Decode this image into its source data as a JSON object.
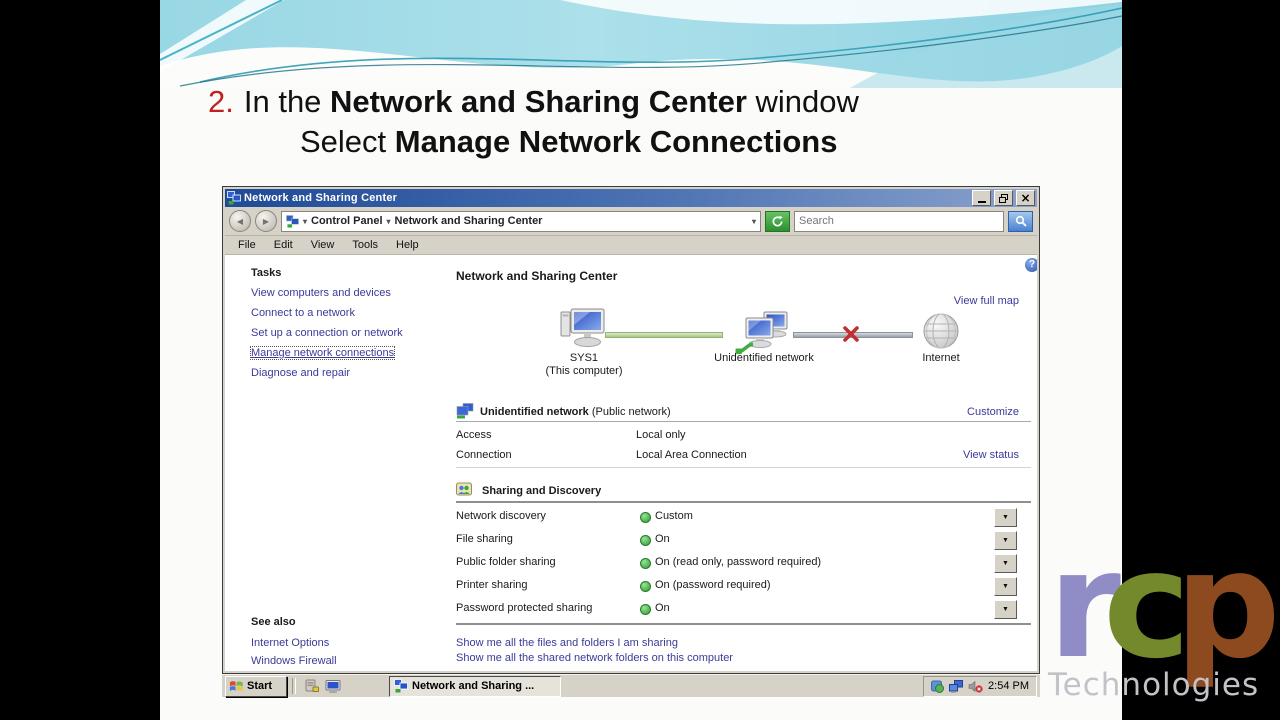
{
  "slide": {
    "step_number": "2.",
    "title": {
      "pre1": "In the ",
      "bold1": "Network and Sharing Center",
      "post1": " window",
      "pre2": "Select ",
      "bold2": "Manage Network Connections"
    }
  },
  "window": {
    "title": "Network and Sharing Center",
    "address": {
      "root": "Control Panel",
      "current": "Network and Sharing Center",
      "search_placeholder": "Search"
    },
    "menu": [
      "File",
      "Edit",
      "View",
      "Tools",
      "Help"
    ],
    "tasks": {
      "header": "Tasks",
      "items": [
        "View computers and devices",
        "Connect to a network",
        "Set up a connection or network",
        "Manage network connections",
        "Diagnose and repair"
      ],
      "selected": "Manage network connections"
    },
    "see_also": {
      "header": "See also",
      "items": [
        "Internet Options",
        "Windows Firewall"
      ]
    },
    "main": {
      "heading": "Network and Sharing Center",
      "view_full_map": "View full map",
      "map": {
        "nodes": [
          {
            "label": "SYS1",
            "sublabel": "(This computer)"
          },
          {
            "label": "Unidentified network",
            "sublabel": ""
          },
          {
            "label": "Internet",
            "sublabel": ""
          }
        ],
        "link_local_status": "connected",
        "link_internet_status": "disconnected"
      },
      "network_section": {
        "title": "Unidentified network",
        "subtitle": "(Public network)",
        "customize_link": "Customize",
        "rows": [
          {
            "label": "Access",
            "value": "Local only",
            "link": ""
          },
          {
            "label": "Connection",
            "value": "Local Area Connection",
            "link": "View status"
          }
        ]
      },
      "sharing_section": {
        "title": "Sharing and Discovery",
        "rows": [
          {
            "label": "Network discovery",
            "value": "Custom"
          },
          {
            "label": "File sharing",
            "value": "On"
          },
          {
            "label": "Public folder sharing",
            "value": "On (read only, password required)"
          },
          {
            "label": "Printer sharing",
            "value": "On (password required)"
          },
          {
            "label": "Password protected sharing",
            "value": "On"
          }
        ]
      },
      "footer_links": [
        "Show me all the files and folders I am sharing",
        "Show me all the shared network folders on this computer"
      ]
    }
  },
  "taskbar": {
    "start_label": "Start",
    "task_button_label": "Network and Sharing ...",
    "time": "2:54 PM"
  },
  "logo": {
    "letter1": "r",
    "letter2": "c",
    "letter3": "p",
    "text": "Technologies"
  },
  "icons": {
    "help": "?",
    "dropdown": "▼",
    "close": "×",
    "minimize": "_",
    "restore": "overlapping-squares",
    "back": "◀",
    "forward": "▶",
    "breadcrumb_arrow": "▸",
    "search": "magnifier",
    "refresh": "circular-arrow"
  },
  "colors": {
    "titlebar_left": "#1f4a96",
    "titlebar_right": "#8aa2cc",
    "link": "#3a3a99",
    "status_green": "#2e9e2e",
    "disconnect_red": "#c23030",
    "swoosh_teal": "#8fd2e2",
    "logo_purple": "#8f8cc6",
    "logo_green": "#74882c",
    "logo_brown": "#8d4a1f"
  }
}
